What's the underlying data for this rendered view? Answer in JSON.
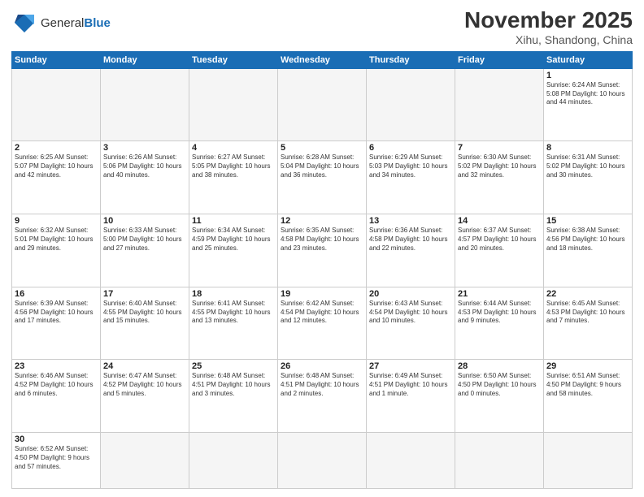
{
  "header": {
    "logo_general": "General",
    "logo_blue": "Blue",
    "title": "November 2025",
    "subtitle": "Xihu, Shandong, China"
  },
  "days_of_week": [
    "Sunday",
    "Monday",
    "Tuesday",
    "Wednesday",
    "Thursday",
    "Friday",
    "Saturday"
  ],
  "weeks": [
    [
      {
        "day": "",
        "info": ""
      },
      {
        "day": "",
        "info": ""
      },
      {
        "day": "",
        "info": ""
      },
      {
        "day": "",
        "info": ""
      },
      {
        "day": "",
        "info": ""
      },
      {
        "day": "",
        "info": ""
      },
      {
        "day": "1",
        "info": "Sunrise: 6:24 AM\nSunset: 5:08 PM\nDaylight: 10 hours and 44 minutes."
      }
    ],
    [
      {
        "day": "2",
        "info": "Sunrise: 6:25 AM\nSunset: 5:07 PM\nDaylight: 10 hours and 42 minutes."
      },
      {
        "day": "3",
        "info": "Sunrise: 6:26 AM\nSunset: 5:06 PM\nDaylight: 10 hours and 40 minutes."
      },
      {
        "day": "4",
        "info": "Sunrise: 6:27 AM\nSunset: 5:05 PM\nDaylight: 10 hours and 38 minutes."
      },
      {
        "day": "5",
        "info": "Sunrise: 6:28 AM\nSunset: 5:04 PM\nDaylight: 10 hours and 36 minutes."
      },
      {
        "day": "6",
        "info": "Sunrise: 6:29 AM\nSunset: 5:03 PM\nDaylight: 10 hours and 34 minutes."
      },
      {
        "day": "7",
        "info": "Sunrise: 6:30 AM\nSunset: 5:02 PM\nDaylight: 10 hours and 32 minutes."
      },
      {
        "day": "8",
        "info": "Sunrise: 6:31 AM\nSunset: 5:02 PM\nDaylight: 10 hours and 30 minutes."
      }
    ],
    [
      {
        "day": "9",
        "info": "Sunrise: 6:32 AM\nSunset: 5:01 PM\nDaylight: 10 hours and 29 minutes."
      },
      {
        "day": "10",
        "info": "Sunrise: 6:33 AM\nSunset: 5:00 PM\nDaylight: 10 hours and 27 minutes."
      },
      {
        "day": "11",
        "info": "Sunrise: 6:34 AM\nSunset: 4:59 PM\nDaylight: 10 hours and 25 minutes."
      },
      {
        "day": "12",
        "info": "Sunrise: 6:35 AM\nSunset: 4:58 PM\nDaylight: 10 hours and 23 minutes."
      },
      {
        "day": "13",
        "info": "Sunrise: 6:36 AM\nSunset: 4:58 PM\nDaylight: 10 hours and 22 minutes."
      },
      {
        "day": "14",
        "info": "Sunrise: 6:37 AM\nSunset: 4:57 PM\nDaylight: 10 hours and 20 minutes."
      },
      {
        "day": "15",
        "info": "Sunrise: 6:38 AM\nSunset: 4:56 PM\nDaylight: 10 hours and 18 minutes."
      }
    ],
    [
      {
        "day": "16",
        "info": "Sunrise: 6:39 AM\nSunset: 4:56 PM\nDaylight: 10 hours and 17 minutes."
      },
      {
        "day": "17",
        "info": "Sunrise: 6:40 AM\nSunset: 4:55 PM\nDaylight: 10 hours and 15 minutes."
      },
      {
        "day": "18",
        "info": "Sunrise: 6:41 AM\nSunset: 4:55 PM\nDaylight: 10 hours and 13 minutes."
      },
      {
        "day": "19",
        "info": "Sunrise: 6:42 AM\nSunset: 4:54 PM\nDaylight: 10 hours and 12 minutes."
      },
      {
        "day": "20",
        "info": "Sunrise: 6:43 AM\nSunset: 4:54 PM\nDaylight: 10 hours and 10 minutes."
      },
      {
        "day": "21",
        "info": "Sunrise: 6:44 AM\nSunset: 4:53 PM\nDaylight: 10 hours and 9 minutes."
      },
      {
        "day": "22",
        "info": "Sunrise: 6:45 AM\nSunset: 4:53 PM\nDaylight: 10 hours and 7 minutes."
      }
    ],
    [
      {
        "day": "23",
        "info": "Sunrise: 6:46 AM\nSunset: 4:52 PM\nDaylight: 10 hours and 6 minutes."
      },
      {
        "day": "24",
        "info": "Sunrise: 6:47 AM\nSunset: 4:52 PM\nDaylight: 10 hours and 5 minutes."
      },
      {
        "day": "25",
        "info": "Sunrise: 6:48 AM\nSunset: 4:51 PM\nDaylight: 10 hours and 3 minutes."
      },
      {
        "day": "26",
        "info": "Sunrise: 6:48 AM\nSunset: 4:51 PM\nDaylight: 10 hours and 2 minutes."
      },
      {
        "day": "27",
        "info": "Sunrise: 6:49 AM\nSunset: 4:51 PM\nDaylight: 10 hours and 1 minute."
      },
      {
        "day": "28",
        "info": "Sunrise: 6:50 AM\nSunset: 4:50 PM\nDaylight: 10 hours and 0 minutes."
      },
      {
        "day": "29",
        "info": "Sunrise: 6:51 AM\nSunset: 4:50 PM\nDaylight: 9 hours and 58 minutes."
      }
    ],
    [
      {
        "day": "30",
        "info": "Sunrise: 6:52 AM\nSunset: 4:50 PM\nDaylight: 9 hours and 57 minutes."
      },
      {
        "day": "",
        "info": ""
      },
      {
        "day": "",
        "info": ""
      },
      {
        "day": "",
        "info": ""
      },
      {
        "day": "",
        "info": ""
      },
      {
        "day": "",
        "info": ""
      },
      {
        "day": "",
        "info": ""
      }
    ]
  ]
}
